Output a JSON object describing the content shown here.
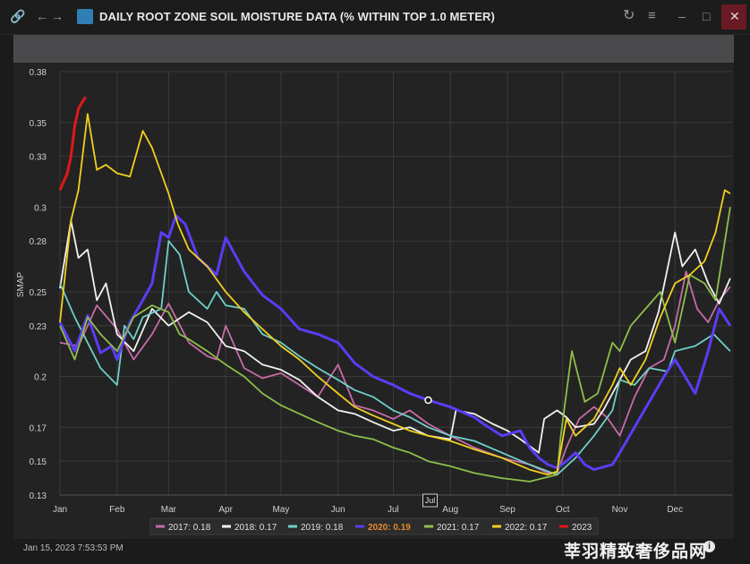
{
  "window": {
    "title": "DAILY ROOT ZONE SOIL MOISTURE DATA (% WITHIN TOP 1.0 METER)",
    "timestamp": "Jan 15, 2023 7:53:53 PM",
    "watermark": "莘羽精致奢侈品网",
    "icons": [
      "link-icon",
      "back-arrow-icon",
      "forward-arrow-icon",
      "app-icon",
      "refresh-icon",
      "menu-icon",
      "minimize-icon",
      "maximize-icon",
      "close-icon"
    ]
  },
  "chart_data": {
    "type": "line",
    "ylabel": "SMAP",
    "ylim": [
      0.13,
      0.38
    ],
    "yticks": [
      0.13,
      0.15,
      0.17,
      0.2,
      0.23,
      0.25,
      0.28,
      0.3,
      0.33,
      0.35,
      0.38
    ],
    "ytick_labels": [
      "0.13",
      "0.15",
      "0.17",
      "0.2",
      "0.23",
      "0.25",
      "0.28",
      "0.3",
      "0.33",
      "0.35",
      "0.38"
    ],
    "x_months": [
      "Jan",
      "Feb",
      "Mar",
      "Apr",
      "May",
      "Jun",
      "Jul",
      "Aug",
      "Sep",
      "Oct",
      "Nov",
      "Dec"
    ],
    "x_month_start_day": [
      0,
      31,
      59,
      90,
      120,
      151,
      181,
      212,
      243,
      273,
      304,
      334
    ],
    "xlim_days": [
      0,
      365
    ],
    "grid": true,
    "legend_position": "bottom",
    "crosshair_label": "Jul",
    "hover_point": {
      "series": "2020",
      "day": 200,
      "value": 0.186
    },
    "series": [
      {
        "name": "2017",
        "legend": "2017: 0.18",
        "color": "#c76ba8",
        "x": [
          0,
          10,
          20,
          31,
          40,
          50,
          59,
          70,
          80,
          85,
          90,
          100,
          110,
          120,
          130,
          140,
          151,
          160,
          170,
          181,
          190,
          200,
          212,
          225,
          240,
          255,
          265,
          270,
          275,
          282,
          290,
          297,
          304,
          312,
          320,
          328,
          334,
          340,
          346,
          352,
          358,
          364
        ],
        "y": [
          0.22,
          0.218,
          0.242,
          0.228,
          0.21,
          0.225,
          0.243,
          0.22,
          0.212,
          0.21,
          0.23,
          0.205,
          0.199,
          0.202,
          0.195,
          0.188,
          0.207,
          0.183,
          0.18,
          0.175,
          0.18,
          0.172,
          0.165,
          0.158,
          0.152,
          0.148,
          0.143,
          0.143,
          0.158,
          0.175,
          0.182,
          0.176,
          0.165,
          0.188,
          0.205,
          0.21,
          0.23,
          0.262,
          0.24,
          0.232,
          0.245,
          0.253
        ]
      },
      {
        "name": "2018",
        "legend": "2018: 0.17",
        "color": "#f2f2f2",
        "x": [
          0,
          6,
          10,
          15,
          20,
          25,
          31,
          40,
          50,
          59,
          70,
          80,
          90,
          100,
          110,
          120,
          130,
          140,
          151,
          160,
          170,
          181,
          190,
          200,
          212,
          215,
          225,
          235,
          243,
          250,
          260,
          263,
          270,
          275,
          280,
          290,
          295,
          300,
          304,
          310,
          318,
          325,
          334,
          338,
          345,
          352,
          358,
          364
        ],
        "y": [
          0.252,
          0.292,
          0.27,
          0.275,
          0.245,
          0.255,
          0.225,
          0.215,
          0.24,
          0.23,
          0.238,
          0.232,
          0.218,
          0.215,
          0.207,
          0.204,
          0.198,
          0.188,
          0.18,
          0.178,
          0.173,
          0.168,
          0.17,
          0.165,
          0.163,
          0.18,
          0.178,
          0.172,
          0.168,
          0.163,
          0.155,
          0.175,
          0.18,
          0.176,
          0.17,
          0.172,
          0.18,
          0.19,
          0.198,
          0.21,
          0.215,
          0.238,
          0.285,
          0.265,
          0.275,
          0.255,
          0.243,
          0.258
        ]
      },
      {
        "name": "2019",
        "legend": "2019: 0.18",
        "color": "#6fcfc9",
        "x": [
          0,
          8,
          15,
          22,
          31,
          35,
          40,
          45,
          55,
          59,
          65,
          70,
          80,
          85,
          90,
          100,
          110,
          120,
          130,
          140,
          151,
          160,
          170,
          181,
          190,
          200,
          212,
          225,
          240,
          255,
          270,
          280,
          290,
          300,
          304,
          312,
          320,
          330,
          334,
          345,
          355,
          364
        ],
        "y": [
          0.255,
          0.235,
          0.22,
          0.205,
          0.195,
          0.23,
          0.222,
          0.235,
          0.24,
          0.28,
          0.272,
          0.25,
          0.24,
          0.25,
          0.242,
          0.24,
          0.225,
          0.22,
          0.212,
          0.205,
          0.198,
          0.192,
          0.188,
          0.18,
          0.176,
          0.17,
          0.165,
          0.162,
          0.155,
          0.148,
          0.142,
          0.152,
          0.165,
          0.18,
          0.198,
          0.195,
          0.205,
          0.203,
          0.215,
          0.218,
          0.225,
          0.215
        ]
      },
      {
        "name": "2020",
        "legend": "2020: 0.19",
        "color": "#5b3cf5",
        "x": [
          0,
          8,
          15,
          22,
          28,
          31,
          38,
          45,
          50,
          55,
          59,
          63,
          68,
          75,
          85,
          90,
          100,
          110,
          120,
          130,
          140,
          151,
          160,
          170,
          181,
          190,
          200,
          212,
          225,
          230,
          240,
          250,
          255,
          260,
          265,
          270,
          275,
          280,
          285,
          290,
          300,
          304,
          312,
          320,
          328,
          334,
          345,
          352,
          358,
          364
        ],
        "y": [
          0.232,
          0.215,
          0.236,
          0.214,
          0.218,
          0.21,
          0.232,
          0.245,
          0.255,
          0.285,
          0.282,
          0.295,
          0.29,
          0.27,
          0.26,
          0.282,
          0.262,
          0.248,
          0.24,
          0.228,
          0.225,
          0.22,
          0.208,
          0.2,
          0.195,
          0.19,
          0.186,
          0.182,
          0.176,
          0.172,
          0.165,
          0.168,
          0.158,
          0.152,
          0.148,
          0.146,
          0.15,
          0.155,
          0.148,
          0.145,
          0.148,
          0.155,
          0.17,
          0.185,
          0.2,
          0.21,
          0.19,
          0.215,
          0.24,
          0.23
        ]
      },
      {
        "name": "2021",
        "legend": "2021: 0.17",
        "color": "#8fbf4a",
        "x": [
          0,
          8,
          15,
          22,
          31,
          40,
          50,
          59,
          65,
          70,
          80,
          90,
          100,
          110,
          120,
          130,
          140,
          151,
          160,
          170,
          181,
          190,
          200,
          212,
          225,
          240,
          255,
          270,
          272,
          278,
          285,
          292,
          300,
          304,
          310,
          318,
          326,
          334,
          342,
          350,
          356,
          364
        ],
        "y": [
          0.23,
          0.21,
          0.235,
          0.225,
          0.215,
          0.235,
          0.242,
          0.238,
          0.225,
          0.222,
          0.215,
          0.207,
          0.2,
          0.19,
          0.183,
          0.178,
          0.173,
          0.168,
          0.165,
          0.163,
          0.158,
          0.155,
          0.15,
          0.147,
          0.143,
          0.14,
          0.138,
          0.142,
          0.165,
          0.215,
          0.185,
          0.19,
          0.22,
          0.215,
          0.23,
          0.24,
          0.25,
          0.22,
          0.26,
          0.255,
          0.245,
          0.3
        ]
      },
      {
        "name": "2022",
        "legend": "2022: 0.17",
        "color": "#f0d020",
        "x": [
          0,
          6,
          10,
          15,
          20,
          25,
          31,
          38,
          45,
          50,
          55,
          59,
          64,
          70,
          80,
          90,
          100,
          110,
          120,
          130,
          140,
          151,
          160,
          170,
          181,
          190,
          200,
          212,
          225,
          240,
          255,
          265,
          270,
          275,
          280,
          290,
          300,
          304,
          310,
          318,
          326,
          334,
          342,
          350,
          356,
          361,
          364
        ],
        "y": [
          0.232,
          0.292,
          0.31,
          0.355,
          0.322,
          0.325,
          0.32,
          0.318,
          0.345,
          0.335,
          0.32,
          0.308,
          0.29,
          0.275,
          0.265,
          0.25,
          0.238,
          0.228,
          0.218,
          0.21,
          0.2,
          0.19,
          0.182,
          0.177,
          0.172,
          0.168,
          0.165,
          0.162,
          0.157,
          0.152,
          0.145,
          0.142,
          0.144,
          0.175,
          0.165,
          0.175,
          0.195,
          0.205,
          0.195,
          0.21,
          0.235,
          0.255,
          0.26,
          0.268,
          0.285,
          0.31,
          0.308
        ]
      },
      {
        "name": "2023",
        "legend": "2023",
        "color": "#e01818",
        "x": [
          0,
          2,
          4,
          6,
          8,
          10,
          12,
          14
        ],
        "y": [
          0.31,
          0.315,
          0.32,
          0.33,
          0.348,
          0.358,
          0.362,
          0.365
        ]
      }
    ]
  }
}
